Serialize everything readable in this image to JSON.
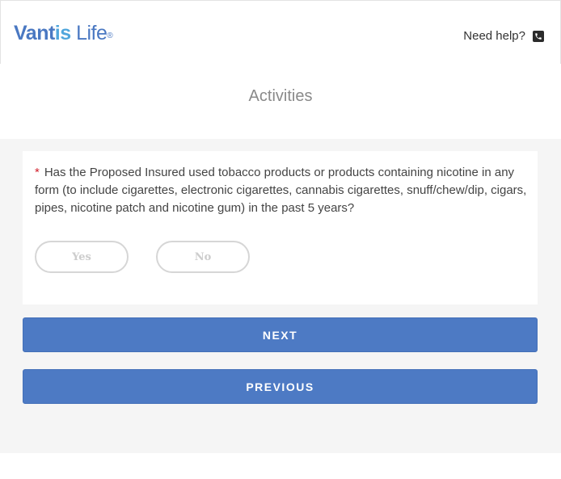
{
  "header": {
    "logo": {
      "brand_main": "Vantis",
      "brand_accent": " Life",
      "registered": "®"
    },
    "help_label": "Need help?",
    "help_icon": "phone-icon"
  },
  "page": {
    "title": "Activities"
  },
  "question": {
    "required_marker": "*",
    "text": "Has the Proposed Insured used tobacco products or products containing nicotine in any form (to include cigarettes, electronic cigarettes, cannabis cigarettes, snuff/chew/dip, cigars, pipes, nicotine patch and nicotine gum) in the past 5 years?",
    "options": {
      "yes": "Yes",
      "no": "No"
    }
  },
  "actions": {
    "next": "NEXT",
    "previous": "PREVIOUS"
  },
  "colors": {
    "brand_blue": "#4a78c2",
    "button_blue": "#4d7ac4",
    "required_red": "#d21f2b",
    "background_gray": "#f5f5f5"
  }
}
